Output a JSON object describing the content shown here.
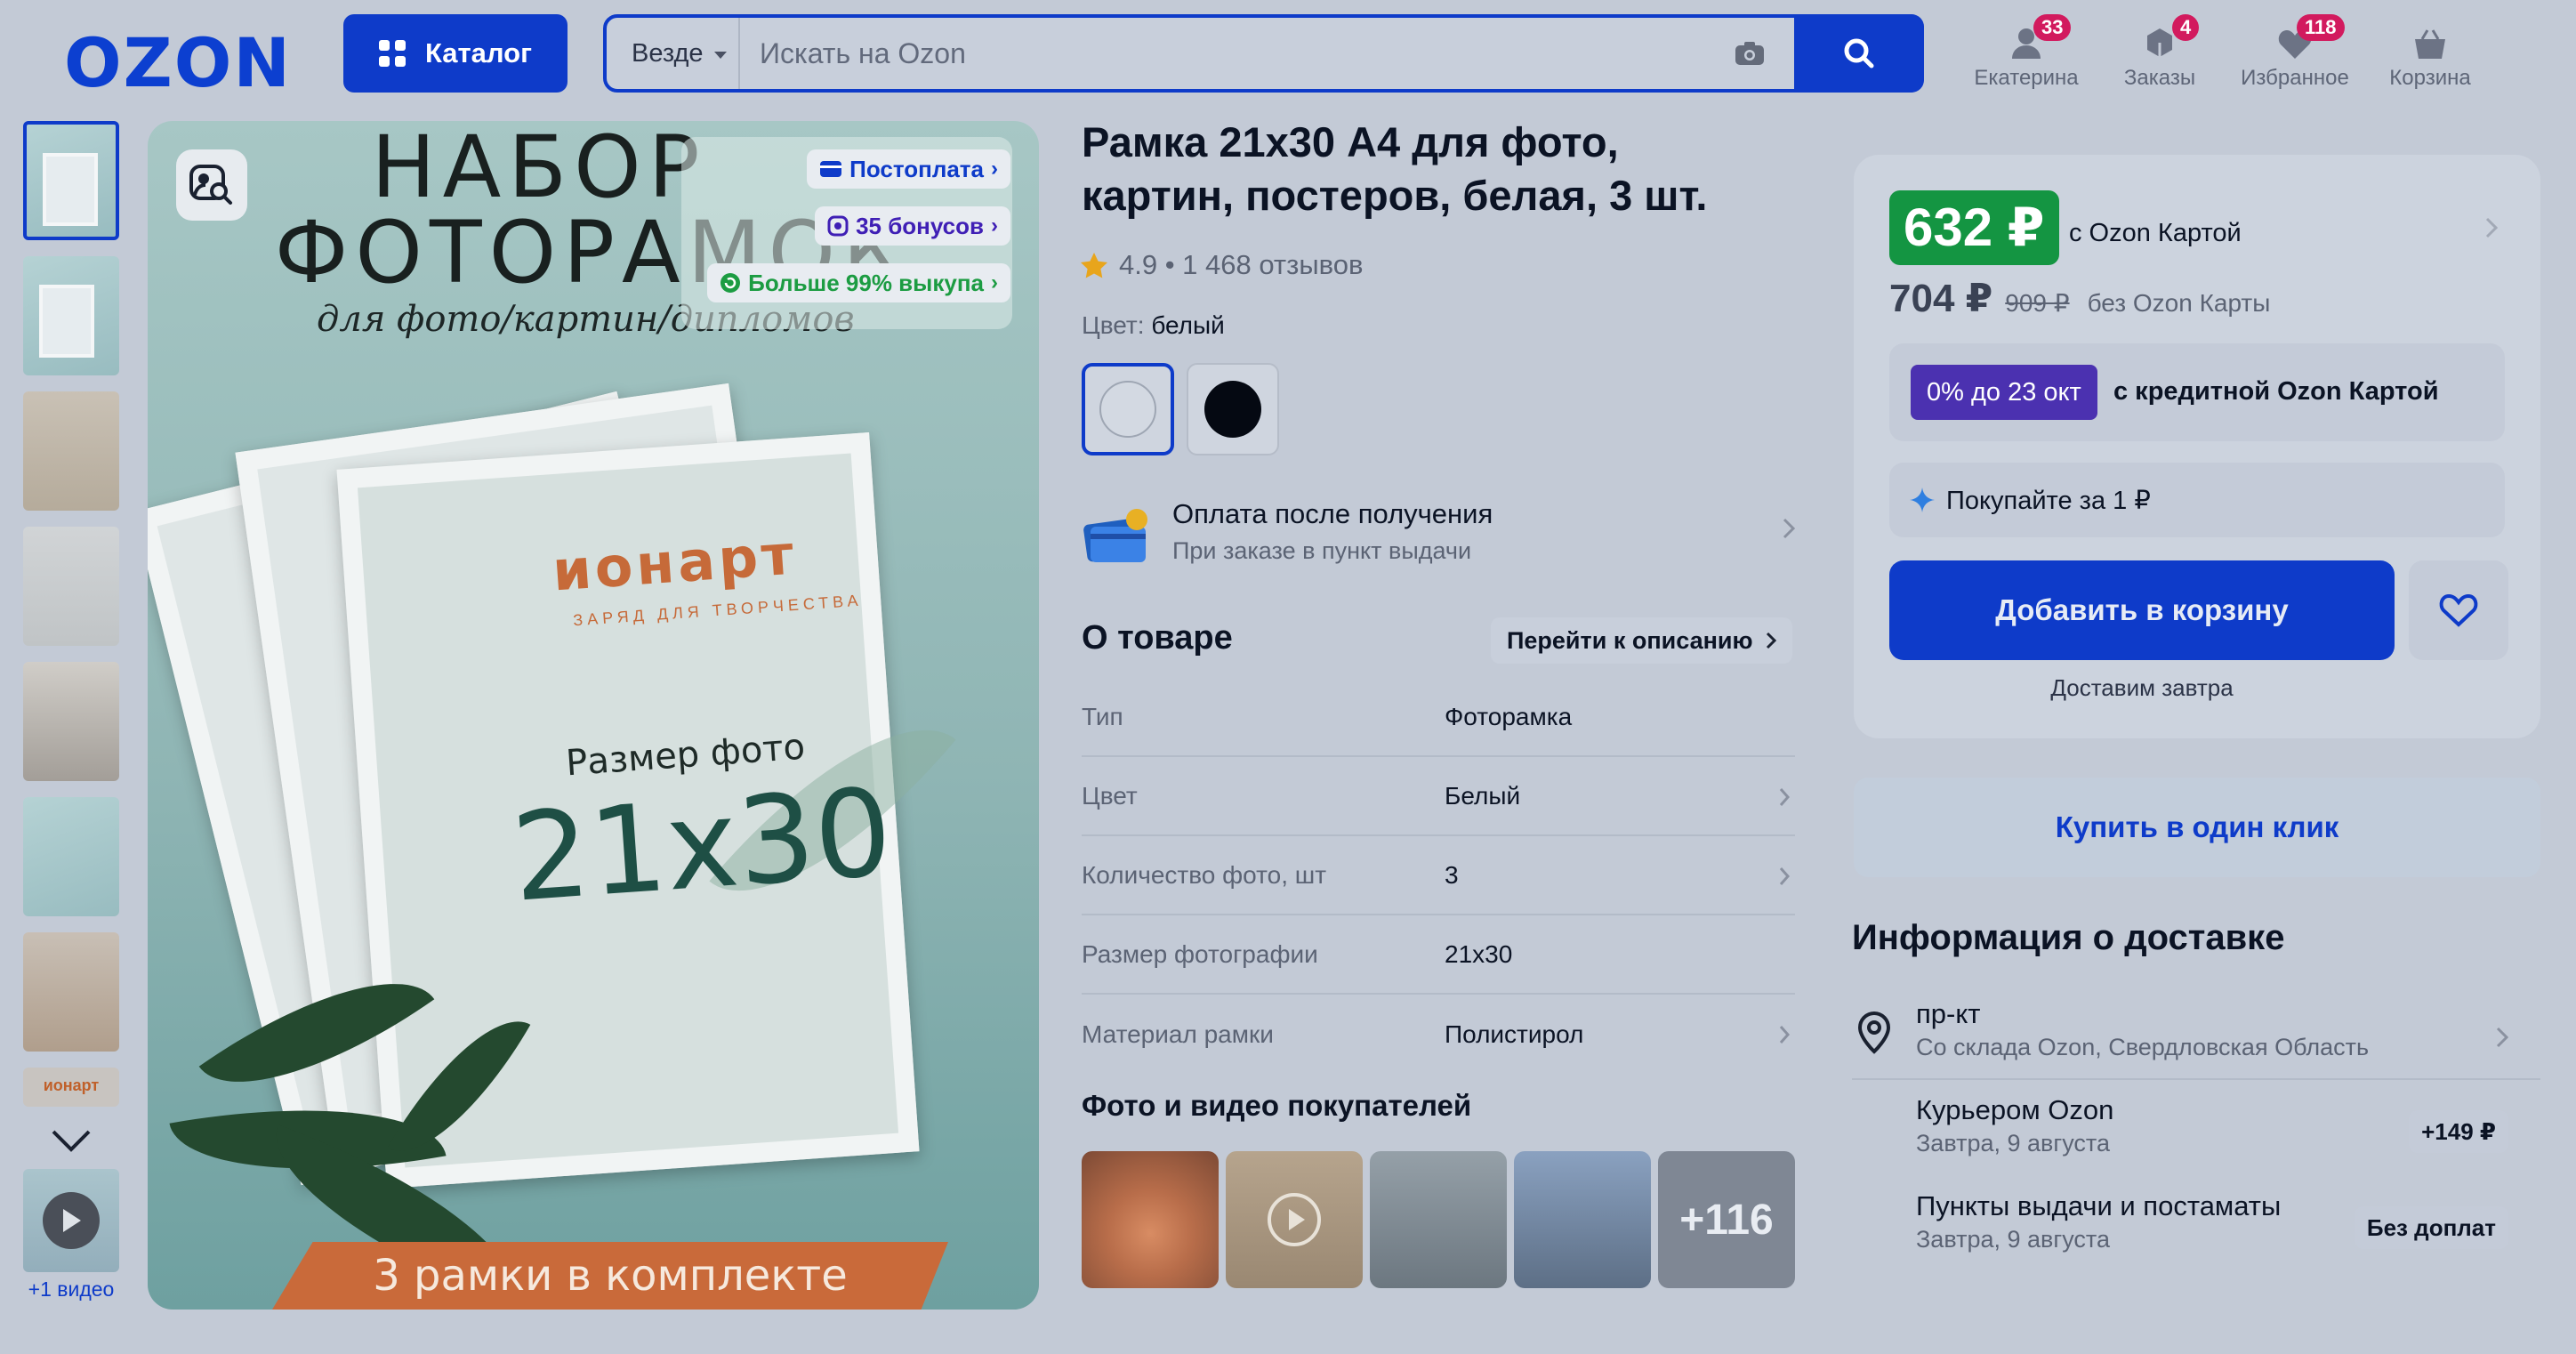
{
  "header": {
    "logo": "OZON",
    "catalog_label": "Каталог",
    "search_scope": "Везде",
    "search_placeholder": "Искать на Ozon",
    "nav": [
      {
        "label": "Екатерина",
        "badge": "33"
      },
      {
        "label": "Заказы",
        "badge": "4"
      },
      {
        "label": "Избранное",
        "badge": "118"
      },
      {
        "label": "Корзина",
        "badge": ""
      }
    ]
  },
  "gallery": {
    "thumb_brand_text": "ионарт",
    "video_label": "+1 видео",
    "image": {
      "title_line1": "НАБОР",
      "title_line2": "ФОТОРАМОК",
      "subtitle": "для фото/картин/дипломов",
      "brand": "ионарт",
      "brand_sub": "ЗАРЯД ДЛЯ ТВОРЧЕСТВА",
      "size_label": "Размер фото",
      "size_value": "21x30",
      "banner": "3 рамки в комплекте"
    },
    "tags": {
      "postpay": "Постоплата",
      "bonus": "35 бонусов",
      "buyout": "Больше 99% выкупа"
    }
  },
  "product": {
    "title": "Рамка 21х30 А4 для фото, картин, постеров, белая, 3 шт.",
    "rating": "4.9 • 1 468 отзывов",
    "color_label": "Цвет:",
    "color_value": "белый",
    "payment_title": "Оплата после получения",
    "payment_sub": "При заказе в пункт выдачи",
    "about_title": "О товаре",
    "about_link": "Перейти к описанию",
    "props": [
      {
        "key": "Тип",
        "value": "Фоторамка"
      },
      {
        "key": "Цвет",
        "value": "Белый"
      },
      {
        "key": "Количество фото, шт",
        "value": "3"
      },
      {
        "key": "Размер фотографии",
        "value": "21x30"
      },
      {
        "key": "Материал рамки",
        "value": "Полистирол"
      }
    ],
    "ugc_title": "Фото и видео покупателей",
    "ugc_more": "+116"
  },
  "buybox": {
    "price_card": "632 ₽",
    "price_card_label": "с Ozon Картой",
    "price": "704 ₽",
    "price_old": "909 ₽",
    "price_no_card": "без Ozon Карты",
    "credit_tag": "0% до 23 окт",
    "credit_label": "с кредитной Ozon Картой",
    "split_label": "Покупайте за 1 ₽",
    "add_to_cart": "Добавить в корзину",
    "deliver": "Доставим завтра",
    "one_click": "Купить в один клик"
  },
  "delivery": {
    "title": "Информация о доставке",
    "address": "пр-кт",
    "address_sub": "Со склада Ozon, Свердловская Область",
    "options": [
      {
        "title": "Курьером Ozon",
        "sub": "Завтра, 9 августа",
        "price": "+149 ₽"
      },
      {
        "title": "Пункты выдачи и постаматы",
        "sub": "Завтра, 9 августа",
        "price": "Без доплат"
      }
    ]
  },
  "colors": {
    "brand_blue": "#0e3bc9",
    "price_green": "#149542",
    "credit_purple": "#4b31b0",
    "badge_pink": "#d21a5e"
  }
}
